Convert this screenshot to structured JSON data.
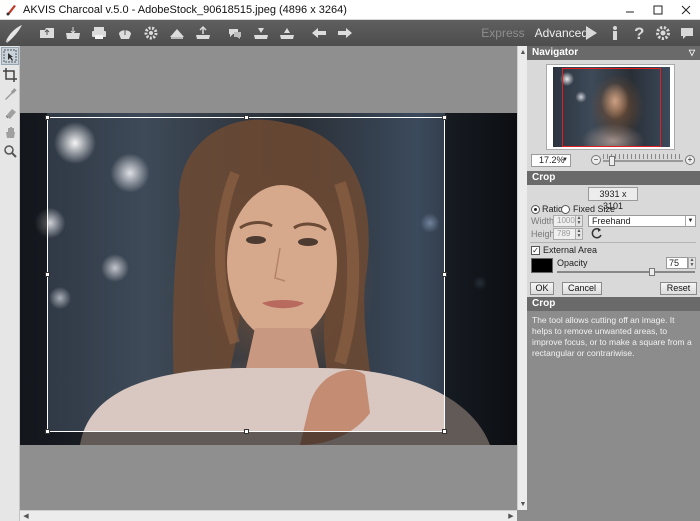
{
  "window": {
    "title": "AKVIS Charcoal v.5.0 - AdobeStock_90618515.jpeg (4896 x 3264)"
  },
  "toolbar": {
    "mode_express": "Express",
    "mode_advanced": "Advanced",
    "left_icons": [
      "brush-logo-icon",
      "open-file-icon",
      "save-icon",
      "print-icon",
      "share-icon",
      "settings-gear-icon",
      "batch-icon",
      "export-icon",
      "before-after-icon",
      "load-preset-icon",
      "save-preset-icon",
      "undo-icon",
      "redo-icon"
    ],
    "right_icons": [
      "run-icon",
      "info-icon",
      "help-icon",
      "preferences-gear-icon",
      "chat-icon"
    ]
  },
  "left_tools": [
    "crop-tool-arrow-icon",
    "crop-icon",
    "pipette-icon",
    "eraser-icon",
    "hand-icon",
    "zoom-icon"
  ],
  "navigator": {
    "title": "Navigator",
    "zoom_value": "17.2%"
  },
  "crop": {
    "title": "Crop",
    "size_display": "3931 x 3101",
    "ratio_label": "Ratio",
    "fixed_size_label": "Fixed Size",
    "selected_mode": "Ratio",
    "width_label": "Width",
    "width_value": "1000",
    "height_label": "Height",
    "height_value": "789",
    "ratio_preset": "Freehand",
    "external_area_label": "External Area",
    "external_area_checked": true,
    "external_color": "#000000",
    "opacity_label": "Opacity",
    "opacity_value": "75",
    "ok_label": "OK",
    "cancel_label": "Cancel",
    "reset_label": "Reset"
  },
  "help": {
    "title": "Crop",
    "text": "The tool allows cutting off an image. It helps to remove unwanted areas, to improve focus, or to make a square from a rectangular or contrariwise."
  },
  "colors": {
    "toolbar_bg": "#555555",
    "panel_bg": "#d9d9d9",
    "panel_header": "#6a6a6a",
    "canvas_bg": "#8f8f8f"
  }
}
